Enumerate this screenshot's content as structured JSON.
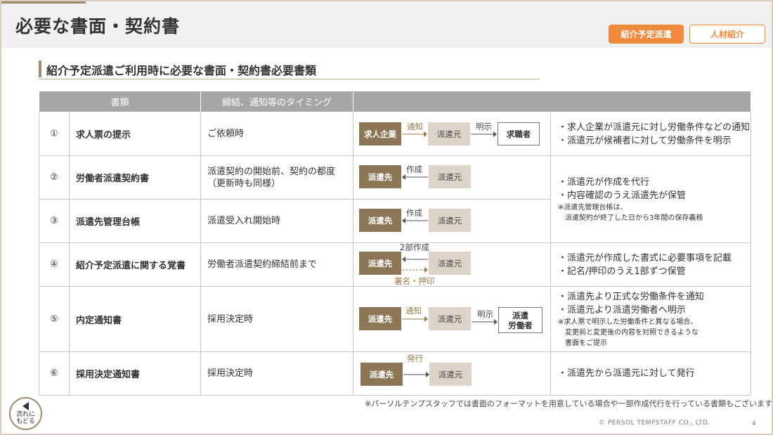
{
  "page": {
    "title": "必要な書面・契約書",
    "tags": {
      "active": "紹介予定派遣",
      "inactive": "人材紹介"
    },
    "section_title": "紹介予定派遣ご利用時に必要な書面・契約書必要書類"
  },
  "table": {
    "headers": [
      "書類",
      "締結、通知等のタイミング",
      ""
    ],
    "rows": [
      {
        "num": "①",
        "name": "求人票の提示",
        "timing": "ご依頼時",
        "flow": {
          "a": "求人企業",
          "a_label": "通知",
          "b": "派遣元",
          "b_label": "明示",
          "c": "求職者"
        },
        "notes": [
          "・求人企業が派遣元に対し労働条件などの通知",
          "・派遣元が候補者に対して労働条件を明示"
        ]
      },
      {
        "num": "②",
        "name": "労働者派遣契約書",
        "timing": "派遣契約の開始前、契約の都度\n（更新時も同様）",
        "flow": {
          "a": "派遣先",
          "label": "作成",
          "b": "派遣元"
        }
      },
      {
        "num": "③",
        "name": "派遣先管理台帳",
        "timing": "派遣受入れ開始時",
        "flow": {
          "a": "派遣先",
          "label": "作成",
          "b": "派遣元"
        }
      },
      {
        "num": "④",
        "name": "紹介予定派遣に関する覚書",
        "timing": "労働者派遣契約締結前まで",
        "flow": {
          "a": "派遣先",
          "top_label": "2部作成",
          "b": "派遣元",
          "bottom_label": "署名・押印"
        },
        "notes": [
          "・派遣元が作成した書式に必要事項を記載",
          "・記名/押印のうえ1部ずつ保管"
        ]
      },
      {
        "num": "⑤",
        "name": "内定通知書",
        "timing": "採用決定時",
        "flow": {
          "a": "派遣先",
          "a_label": "通知",
          "b": "派遣元",
          "b_label": "明示",
          "c": "派遣\n労働者"
        },
        "notes": [
          "・派遣先より正式な労働条件を通知",
          "・派遣元より派遣労働者へ明示"
        ],
        "small_notes": [
          "※求人票で明示した労働条件と異なる場合、",
          "　変更前と変更後の内容を対照できるような",
          "　書面をご提示"
        ]
      },
      {
        "num": "⑥",
        "name": "採用決定通知書",
        "timing": "採用決定時",
        "flow": {
          "a": "派遣先",
          "label": "発行",
          "b": "派遣元"
        },
        "notes": [
          "・派遣先から派遣元に対して発行"
        ]
      }
    ],
    "merged_notes_2_3": {
      "notes": [
        "・派遣元が作成を代行",
        "・内容確認のうえ派遣先が保管"
      ],
      "small_notes": [
        "※派遣先管理台帳は、",
        "　派遣契約が終了した日から3年間の保存義務"
      ]
    }
  },
  "footer": {
    "note": "※パーソルテンプスタッフでは書面のフォーマットを用意している場合や一部作成代行を行っている書類もございます",
    "back_button": "流れに\nもどる",
    "copyright": "© PERSOL TEMPSTAFF CO., LTD.",
    "page_number": "4"
  }
}
